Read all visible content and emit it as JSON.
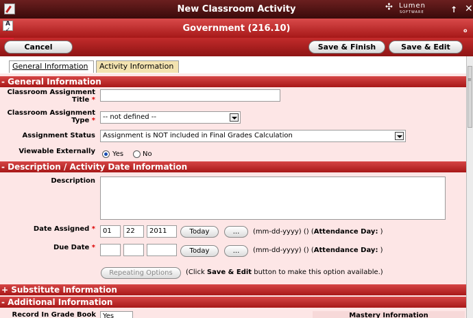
{
  "window": {
    "title": "New Classroom Activity",
    "logo_word": "Lumen",
    "logo_sub": "SOFTWARE"
  },
  "subheader": {
    "title": "Government (216.10)",
    "indicator": "o"
  },
  "toolbar": {
    "cancel": "Cancel",
    "save_finish": "Save & Finish",
    "save_edit": "Save & Edit"
  },
  "tabs": [
    {
      "label": "General Information"
    },
    {
      "label": "Activity Information"
    }
  ],
  "sections": {
    "general": "- General Information",
    "description": "- Description / Activity Date Information",
    "substitute": "+ Substitute Information",
    "additional": "- Additional Information"
  },
  "general": {
    "title_label_1": "Classroom Assignment",
    "title_label_2": "Title",
    "title_value": "",
    "type_label_1": "Classroom Assignment",
    "type_label_2": "Type",
    "type_value": "-- not defined --",
    "status_label": "Assignment Status",
    "status_value": "Assignment is NOT included in Final Grades Calculation",
    "viewable_label": "Viewable Externally",
    "yes": "Yes",
    "no": "No",
    "required_mark": "*"
  },
  "dates": {
    "description_label": "Description",
    "assigned_label": "Date Assigned",
    "assigned_mm": "01",
    "assigned_dd": "22",
    "assigned_yyyy": "2011",
    "due_label": "Due Date",
    "today": "Today",
    "dots": "...",
    "format_hint": "(mm-dd-yyyy) () (",
    "attendance_label": "Attendance Day:",
    "close_paren": ")",
    "repeating": "Repeating Options",
    "repeat_hint_pre": "(Click ",
    "repeat_hint_bold": "Save & Edit",
    "repeat_hint_post": " button to make this option available.)"
  },
  "additional": {
    "record_label": "Record In Grade Book",
    "record_value": "Yes",
    "mastery_label": "Mastery Information"
  },
  "colors": {
    "header_dark": "#3a0a0a",
    "header_red": "#a61818",
    "content_bg": "#fde6e6"
  }
}
